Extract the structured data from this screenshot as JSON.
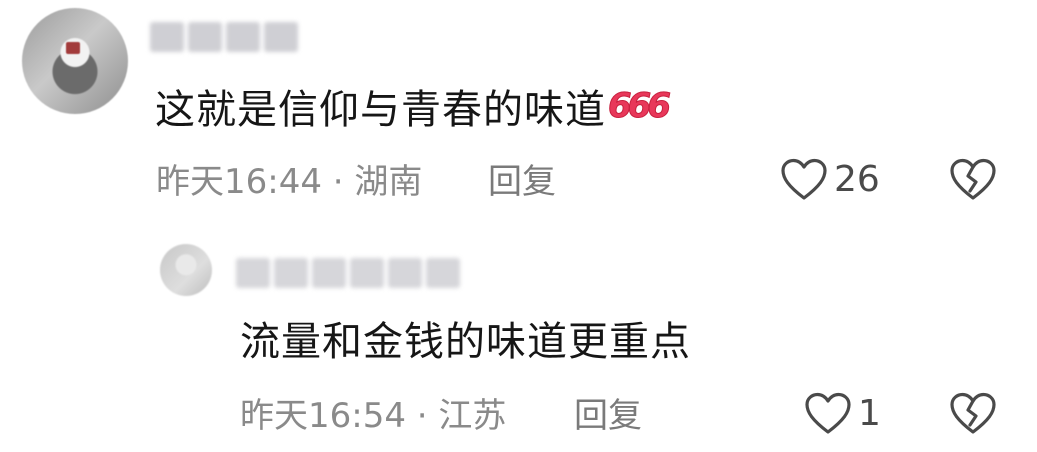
{
  "comments": [
    {
      "text": "这就是信仰与青春的味道",
      "emoji": "666",
      "meta": "昨天16:44 · 湖南",
      "reply_label": "回复",
      "likes": "26"
    },
    {
      "text": "流量和金钱的味道更重点",
      "meta": "昨天16:54 · 江苏",
      "reply_label": "回复",
      "likes": "1"
    }
  ],
  "icons": {
    "like": "heart-outline-icon",
    "dislike": "broken-heart-icon"
  },
  "colors": {
    "text": "#161616",
    "meta": "#8a8a8a",
    "emoji": "#e8385a",
    "icon": "#4a4a4a"
  }
}
